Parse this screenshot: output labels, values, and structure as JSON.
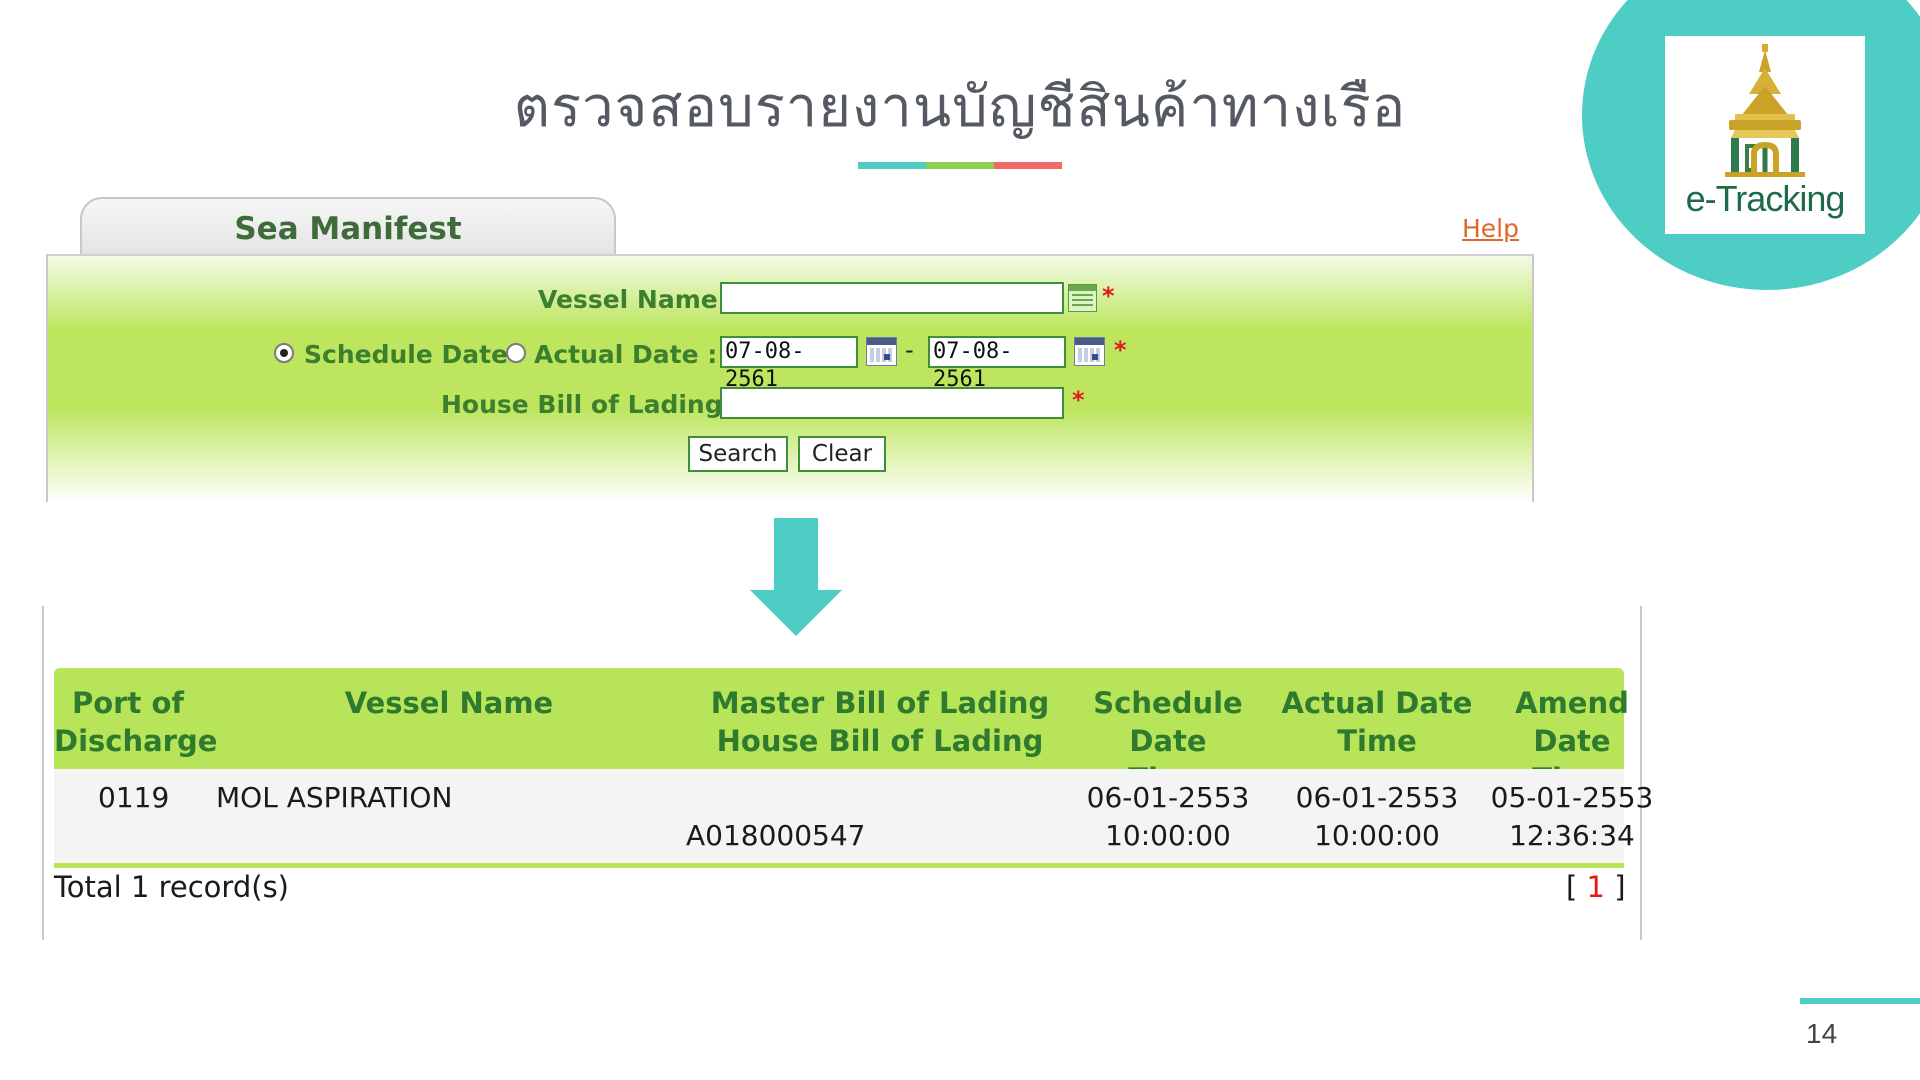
{
  "slide": {
    "title": "ตรวจสอบรายงานบัญชีสินค้าทางเรือ",
    "page_number": "14",
    "underline_colors": [
      "#4ecdc4",
      "#8fd14f",
      "#f06a6a"
    ]
  },
  "logo": {
    "text": "e-Tracking",
    "emblem": "thai-customs-emblem-icon",
    "bg_color": "#4ecdc4"
  },
  "form": {
    "tab_title": "Sea Manifest",
    "help": "Help",
    "vessel_label": "Vessel Name :",
    "vessel_value": "",
    "schedule_label": "Schedule Date",
    "actual_label": "Actual Date :",
    "date_mode": "schedule",
    "date_from": "07-08-2561",
    "date_separator": "-",
    "date_to": "07-08-2561",
    "hbl_label": "House Bill of Lading :",
    "hbl_value": "",
    "required_mark": "*",
    "search_button": "Search",
    "clear_button": "Clear"
  },
  "results": {
    "columns": [
      {
        "line1": "Port of",
        "line2": "Discharge"
      },
      {
        "line1": "Vessel Name",
        "line2": ""
      },
      {
        "line1": "Master Bill of Lading",
        "line2": "House Bill of Lading"
      },
      {
        "line1": "Schedule Date",
        "line2": "Time"
      },
      {
        "line1": "Actual Date",
        "line2": "Time"
      },
      {
        "line1": "Amend Date",
        "line2": "Time"
      }
    ],
    "rows": [
      {
        "port": "0119",
        "vessel": "MOL ASPIRATION",
        "master_bl": "",
        "house_bl": "A018000547",
        "schedule_date": "06-01-2553",
        "schedule_time": "10:00:00",
        "actual_date": "06-01-2553",
        "actual_time": "10:00:00",
        "amend_date": "05-01-2553",
        "amend_time": "12:36:34"
      }
    ],
    "total": "Total 1 record(s)",
    "pager_open": "[",
    "pager_page": "1",
    "pager_close": "]"
  }
}
